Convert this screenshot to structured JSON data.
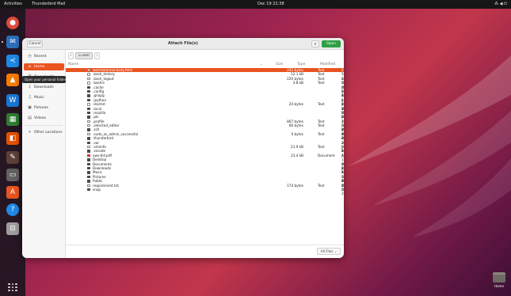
{
  "topbar": {
    "activities": "Activities",
    "app_name": "Thunderbird Mail",
    "clock": "Dec 19 22:38",
    "tray": "⁂ ◀ ⏻"
  },
  "dock": {
    "items": [
      {
        "name": "chrome-icon",
        "color": "#dd4b39",
        "glyph": "●"
      },
      {
        "name": "thunderbird-icon",
        "color": "#2a6ebb",
        "glyph": "✉"
      },
      {
        "name": "vscode-icon",
        "color": "#1e88e5",
        "glyph": "≺"
      },
      {
        "name": "vlc-icon",
        "color": "#f57c00",
        "glyph": "▲"
      },
      {
        "name": "writer-icon",
        "color": "#1976d2",
        "glyph": "W"
      },
      {
        "name": "calc-icon",
        "color": "#2e7d32",
        "glyph": "▦"
      },
      {
        "name": "impress-icon",
        "color": "#e65100",
        "glyph": "◧"
      },
      {
        "name": "gimp-icon",
        "color": "#5d4037",
        "glyph": "✎"
      },
      {
        "name": "drive-icon",
        "color": "#616161",
        "glyph": "▭"
      },
      {
        "name": "software-icon",
        "color": "#e95420",
        "glyph": "A"
      },
      {
        "name": "help-icon",
        "color": "#1e88e5",
        "glyph": "?"
      },
      {
        "name": "trash-icon",
        "color": "#9e9e9e",
        "glyph": "⊟"
      }
    ]
  },
  "desktop": {
    "home_label": "Home"
  },
  "dialog": {
    "title": "Attach File(s)",
    "cancel": "Cancel",
    "open": "Open",
    "search_glyph": "⌕",
    "path_segment": "user",
    "filter": "All Files ⌄",
    "columns": {
      "name": "Name",
      "size": "Size",
      "type": "Type",
      "modified": "Modified",
      "sort_glyph": "⌄"
    },
    "tooltip": "Open your personal folder",
    "sidebar": [
      {
        "label": "Recent",
        "icon": "◷"
      },
      {
        "label": "Home",
        "icon": "⌂"
      },
      {
        "label": "Documents",
        "icon": "🗎"
      },
      {
        "label": "Downloads",
        "icon": "⇩"
      },
      {
        "label": "Music",
        "icon": "♫"
      },
      {
        "label": "Pictures",
        "icon": "▣"
      },
      {
        "label": "Videos",
        "icon": "▤"
      },
      {
        "label": "Other Locations",
        "icon": "+"
      }
    ],
    "files": [
      {
        "name": "wechat/email-body.html",
        "size": "242 bytes",
        "type": "Text",
        "modified": "22:29",
        "kind": "file"
      },
      {
        "name": ".bash_history",
        "size": "12.1 kB",
        "type": "Text",
        "modified": "5 Aug",
        "kind": "file"
      },
      {
        "name": ".bash_logout",
        "size": "220 bytes",
        "type": "Text",
        "modified": "17 Dec 2023",
        "kind": "file"
      },
      {
        "name": ".bashrc",
        "size": "3.8 kB",
        "type": "Text",
        "modified": "17 Dec 2023",
        "kind": "file"
      },
      {
        "name": ".cache",
        "size": "",
        "type": "",
        "modified": "29 Sep 2024",
        "kind": "folder"
      },
      {
        "name": ".config",
        "size": "",
        "type": "",
        "modified": "5 Aug",
        "kind": "folder"
      },
      {
        "name": ".gnupg",
        "size": "",
        "type": "",
        "modified": "18 Jul 2024",
        "kind": "folder"
      },
      {
        "name": ".ipython",
        "size": "",
        "type": "",
        "modified": "16 Jan 2024",
        "kind": "folder"
      },
      {
        "name": ".lesshst",
        "size": "20 bytes",
        "type": "Text",
        "modified": "12 Mar 2024",
        "kind": "file"
      },
      {
        "name": ".local",
        "size": "",
        "type": "",
        "modified": "18 Dec 2023",
        "kind": "folder"
      },
      {
        "name": ".mozilla",
        "size": "",
        "type": "",
        "modified": "16 Jan 2024",
        "kind": "folder"
      },
      {
        "name": ".pki",
        "size": "",
        "type": "",
        "modified": "9 Jan 2024",
        "kind": "folder"
      },
      {
        "name": ".profile",
        "size": "807 bytes",
        "type": "Text",
        "modified": "17 Dec 2023",
        "kind": "file"
      },
      {
        "name": ".selected_editor",
        "size": "66 bytes",
        "type": "Text",
        "modified": "12 Mar 2024",
        "kind": "file"
      },
      {
        "name": ".ssh",
        "size": "",
        "type": "",
        "modified": "12 Mar 2024",
        "kind": "folder"
      },
      {
        "name": ".sudo_as_admin_successful",
        "size": "0 bytes",
        "type": "Text",
        "modified": "18 Dec 2023",
        "kind": "file"
      },
      {
        "name": ".thunderbird",
        "size": "",
        "type": "",
        "modified": "4 Jan 2024",
        "kind": "folder"
      },
      {
        "name": ".var",
        "size": "",
        "type": "",
        "modified": "30 Jan 2024",
        "kind": "folder"
      },
      {
        "name": ".viminfo",
        "size": "21.9 kB",
        "type": "Text",
        "modified": "5 Aug",
        "kind": "file"
      },
      {
        "name": ".vscode",
        "size": "",
        "type": "",
        "modified": "5 Aug",
        "kind": "folder"
      },
      {
        "name": "aws-bill.pdf",
        "size": "23.4 kB",
        "type": "Document",
        "modified": "22:29",
        "kind": "pdf"
      },
      {
        "name": "Desktop",
        "size": "",
        "type": "",
        "modified": "15 Mar 2024",
        "kind": "folder"
      },
      {
        "name": "Documents",
        "size": "",
        "type": "",
        "modified": "28 Jan 2024",
        "kind": "folder"
      },
      {
        "name": "Downloads",
        "size": "",
        "type": "",
        "modified": "5 Aug",
        "kind": "folder"
      },
      {
        "name": "Music",
        "size": "",
        "type": "",
        "modified": "17 Dec 2023",
        "kind": "folder"
      },
      {
        "name": "Pictures",
        "size": "",
        "type": "",
        "modified": "11 Mar 2024",
        "kind": "folder"
      },
      {
        "name": "Public",
        "size": "",
        "type": "",
        "modified": "17 Dec 2023",
        "kind": "folder"
      },
      {
        "name": "requirement.txt",
        "size": "174 bytes",
        "type": "Text",
        "modified": "18 Dec 2023",
        "kind": "file"
      },
      {
        "name": "snap",
        "size": "",
        "type": "",
        "modified": "",
        "kind": "folder"
      }
    ]
  }
}
